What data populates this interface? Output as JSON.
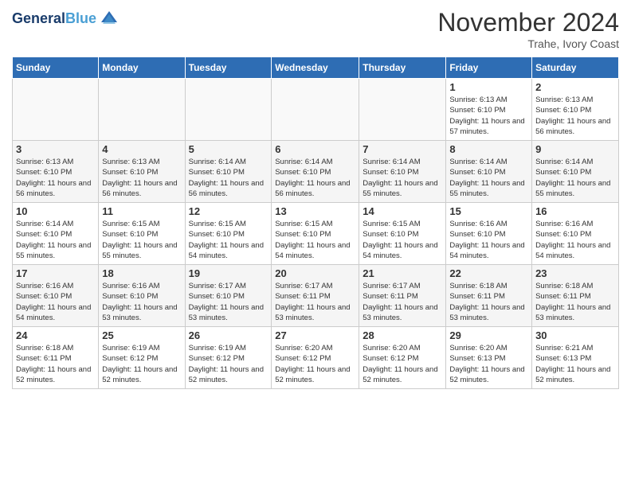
{
  "header": {
    "logo_line1": "General",
    "logo_line2": "Blue",
    "title": "November 2024",
    "subtitle": "Trahe, Ivory Coast"
  },
  "days_of_week": [
    "Sunday",
    "Monday",
    "Tuesday",
    "Wednesday",
    "Thursday",
    "Friday",
    "Saturday"
  ],
  "weeks": [
    [
      {
        "day": "",
        "info": ""
      },
      {
        "day": "",
        "info": ""
      },
      {
        "day": "",
        "info": ""
      },
      {
        "day": "",
        "info": ""
      },
      {
        "day": "",
        "info": ""
      },
      {
        "day": "1",
        "info": "Sunrise: 6:13 AM\nSunset: 6:10 PM\nDaylight: 11 hours and 57 minutes."
      },
      {
        "day": "2",
        "info": "Sunrise: 6:13 AM\nSunset: 6:10 PM\nDaylight: 11 hours and 56 minutes."
      }
    ],
    [
      {
        "day": "3",
        "info": "Sunrise: 6:13 AM\nSunset: 6:10 PM\nDaylight: 11 hours and 56 minutes."
      },
      {
        "day": "4",
        "info": "Sunrise: 6:13 AM\nSunset: 6:10 PM\nDaylight: 11 hours and 56 minutes."
      },
      {
        "day": "5",
        "info": "Sunrise: 6:14 AM\nSunset: 6:10 PM\nDaylight: 11 hours and 56 minutes."
      },
      {
        "day": "6",
        "info": "Sunrise: 6:14 AM\nSunset: 6:10 PM\nDaylight: 11 hours and 56 minutes."
      },
      {
        "day": "7",
        "info": "Sunrise: 6:14 AM\nSunset: 6:10 PM\nDaylight: 11 hours and 55 minutes."
      },
      {
        "day": "8",
        "info": "Sunrise: 6:14 AM\nSunset: 6:10 PM\nDaylight: 11 hours and 55 minutes."
      },
      {
        "day": "9",
        "info": "Sunrise: 6:14 AM\nSunset: 6:10 PM\nDaylight: 11 hours and 55 minutes."
      }
    ],
    [
      {
        "day": "10",
        "info": "Sunrise: 6:14 AM\nSunset: 6:10 PM\nDaylight: 11 hours and 55 minutes."
      },
      {
        "day": "11",
        "info": "Sunrise: 6:15 AM\nSunset: 6:10 PM\nDaylight: 11 hours and 55 minutes."
      },
      {
        "day": "12",
        "info": "Sunrise: 6:15 AM\nSunset: 6:10 PM\nDaylight: 11 hours and 54 minutes."
      },
      {
        "day": "13",
        "info": "Sunrise: 6:15 AM\nSunset: 6:10 PM\nDaylight: 11 hours and 54 minutes."
      },
      {
        "day": "14",
        "info": "Sunrise: 6:15 AM\nSunset: 6:10 PM\nDaylight: 11 hours and 54 minutes."
      },
      {
        "day": "15",
        "info": "Sunrise: 6:16 AM\nSunset: 6:10 PM\nDaylight: 11 hours and 54 minutes."
      },
      {
        "day": "16",
        "info": "Sunrise: 6:16 AM\nSunset: 6:10 PM\nDaylight: 11 hours and 54 minutes."
      }
    ],
    [
      {
        "day": "17",
        "info": "Sunrise: 6:16 AM\nSunset: 6:10 PM\nDaylight: 11 hours and 54 minutes."
      },
      {
        "day": "18",
        "info": "Sunrise: 6:16 AM\nSunset: 6:10 PM\nDaylight: 11 hours and 53 minutes."
      },
      {
        "day": "19",
        "info": "Sunrise: 6:17 AM\nSunset: 6:10 PM\nDaylight: 11 hours and 53 minutes."
      },
      {
        "day": "20",
        "info": "Sunrise: 6:17 AM\nSunset: 6:11 PM\nDaylight: 11 hours and 53 minutes."
      },
      {
        "day": "21",
        "info": "Sunrise: 6:17 AM\nSunset: 6:11 PM\nDaylight: 11 hours and 53 minutes."
      },
      {
        "day": "22",
        "info": "Sunrise: 6:18 AM\nSunset: 6:11 PM\nDaylight: 11 hours and 53 minutes."
      },
      {
        "day": "23",
        "info": "Sunrise: 6:18 AM\nSunset: 6:11 PM\nDaylight: 11 hours and 53 minutes."
      }
    ],
    [
      {
        "day": "24",
        "info": "Sunrise: 6:18 AM\nSunset: 6:11 PM\nDaylight: 11 hours and 52 minutes."
      },
      {
        "day": "25",
        "info": "Sunrise: 6:19 AM\nSunset: 6:12 PM\nDaylight: 11 hours and 52 minutes."
      },
      {
        "day": "26",
        "info": "Sunrise: 6:19 AM\nSunset: 6:12 PM\nDaylight: 11 hours and 52 minutes."
      },
      {
        "day": "27",
        "info": "Sunrise: 6:20 AM\nSunset: 6:12 PM\nDaylight: 11 hours and 52 minutes."
      },
      {
        "day": "28",
        "info": "Sunrise: 6:20 AM\nSunset: 6:12 PM\nDaylight: 11 hours and 52 minutes."
      },
      {
        "day": "29",
        "info": "Sunrise: 6:20 AM\nSunset: 6:13 PM\nDaylight: 11 hours and 52 minutes."
      },
      {
        "day": "30",
        "info": "Sunrise: 6:21 AM\nSunset: 6:13 PM\nDaylight: 11 hours and 52 minutes."
      }
    ]
  ]
}
